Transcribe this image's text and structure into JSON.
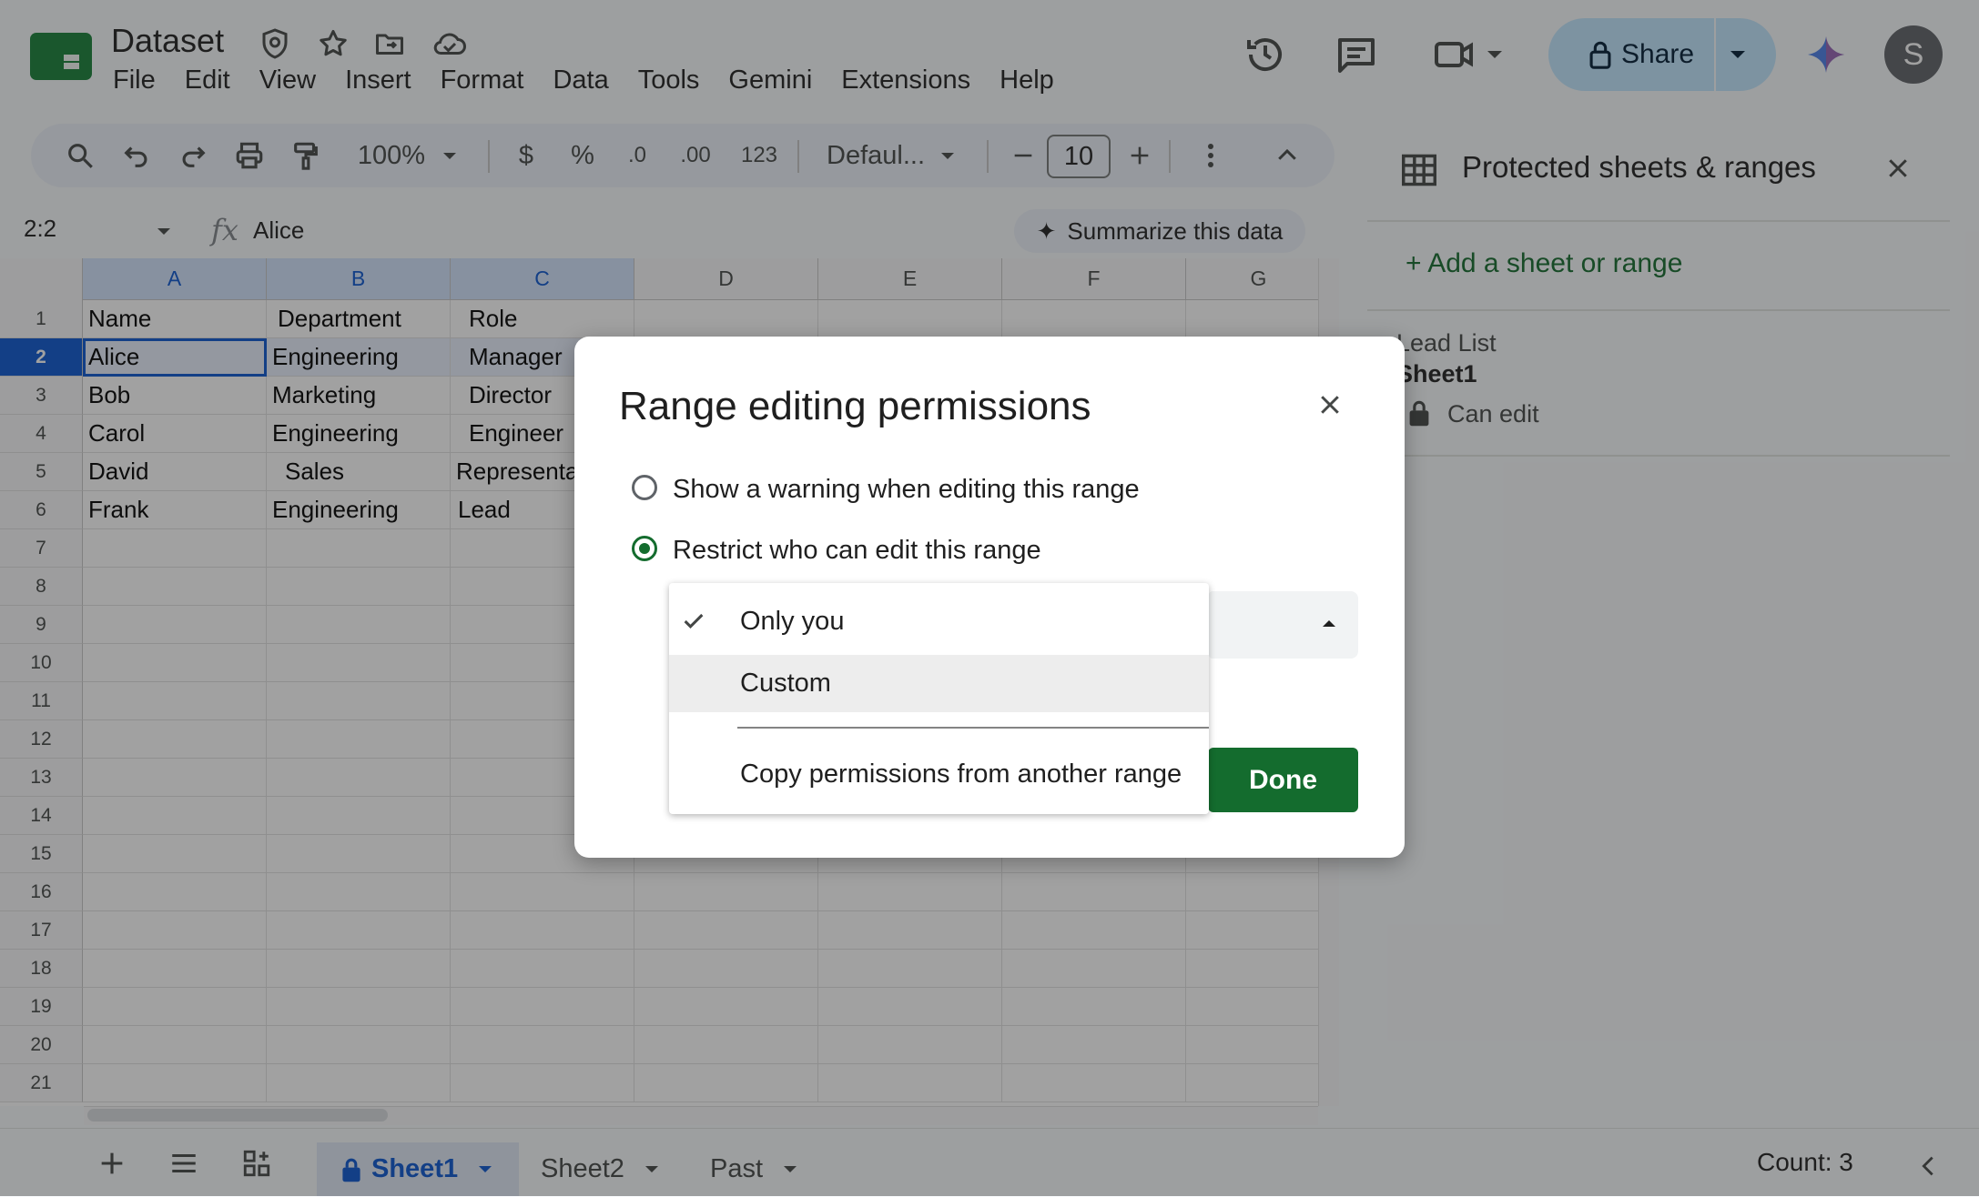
{
  "app": {
    "title": "Dataset",
    "menu": [
      "File",
      "Edit",
      "View",
      "Insert",
      "Format",
      "Data",
      "Tools",
      "Gemini",
      "Extensions",
      "Help"
    ],
    "share_label": "Share",
    "avatar_initial": "S"
  },
  "toolbar": {
    "zoom": "100%",
    "currency": "$",
    "percent": "%",
    "dec_decrease": ".0",
    "dec_increase": ".00",
    "number_format": "123",
    "font": "Defaul...",
    "font_size": "10"
  },
  "formula_bar": {
    "name_box": "2:2",
    "fx": "fx",
    "value": "Alice",
    "summarize_label": "Summarize this data"
  },
  "grid": {
    "columns": [
      "A",
      "B",
      "C",
      "D",
      "E",
      "F",
      "G"
    ],
    "row_numbers": [
      "1",
      "2",
      "3",
      "4",
      "5",
      "6",
      "7",
      "8",
      "9",
      "10",
      "11",
      "12",
      "13",
      "14",
      "15",
      "16",
      "17",
      "18",
      "19",
      "20",
      "21"
    ],
    "rows": [
      [
        "Name",
        "Department",
        "Role"
      ],
      [
        "Alice",
        "Engineering",
        "Manager"
      ],
      [
        "Bob",
        "Marketing",
        "Director"
      ],
      [
        "Carol",
        "Engineering",
        "Engineer"
      ],
      [
        "David",
        "Sales",
        "Representative"
      ],
      [
        "Frank",
        "Engineering",
        "Lead"
      ]
    ]
  },
  "panel": {
    "title": "Protected sheets & ranges",
    "add_label": "+ Add a sheet or range",
    "range_name": "Lead List",
    "range_sheet": "Sheet1",
    "range_permission": "Can edit"
  },
  "dialog": {
    "title": "Range editing permissions",
    "option_warning": "Show a warning when editing this range",
    "option_restrict": "Restrict who can edit this range",
    "selected_option": "restrict",
    "dropdown": {
      "items": [
        "Only you",
        "Custom"
      ],
      "checked_index": 0,
      "hover_index": 1,
      "copy_label": "Copy permissions from another range"
    },
    "done_label": "Done"
  },
  "bottom": {
    "sheets": [
      "Sheet1",
      "Sheet2",
      "Past"
    ],
    "active_sheet_index": 0,
    "status": "Count: 3"
  },
  "colors": {
    "accent_green": "#146c2e",
    "share_bg": "#c2e7ff",
    "selection_blue": "#0b57d0"
  }
}
